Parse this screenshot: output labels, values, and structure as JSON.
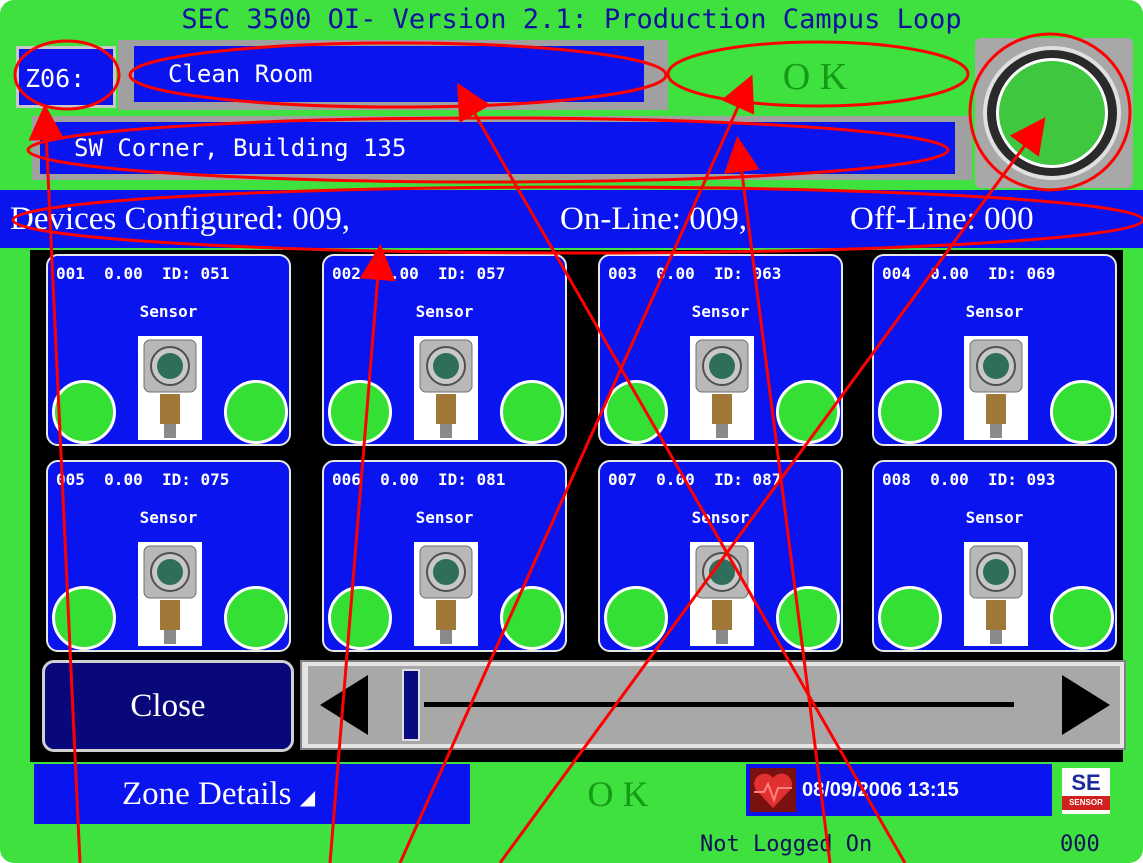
{
  "title": "SEC 3500 OI- Version 2.1: Production Campus Loop",
  "zone": {
    "id": "Z06:",
    "name": "Clean Room",
    "status": "O K",
    "location": "SW Corner, Building 135"
  },
  "summary": {
    "configured": "Devices Configured: 009,",
    "online": "On-Line: 009,",
    "offline": "Off-Line: 000"
  },
  "devices": [
    {
      "number": "001",
      "value": "0.00",
      "id_label": "ID: 051",
      "type": "Sensor"
    },
    {
      "number": "002",
      "value": "0.00",
      "id_label": "ID: 057",
      "type": "Sensor"
    },
    {
      "number": "003",
      "value": "0.00",
      "id_label": "ID: 063",
      "type": "Sensor"
    },
    {
      "number": "004",
      "value": "0.00",
      "id_label": "ID: 069",
      "type": "Sensor"
    },
    {
      "number": "005",
      "value": "0.00",
      "id_label": "ID: 075",
      "type": "Sensor"
    },
    {
      "number": "006",
      "value": "0.00",
      "id_label": "ID: 081",
      "type": "Sensor"
    },
    {
      "number": "007",
      "value": "0.00",
      "id_label": "ID: 087",
      "type": "Sensor"
    },
    {
      "number": "008",
      "value": "0.00",
      "id_label": "ID: 093",
      "type": "Sensor"
    }
  ],
  "controls": {
    "close_label": "Close",
    "zone_details_label": "Zone Details",
    "status_bottom": "O K",
    "datetime": "08/09/2006 13:15",
    "login_status": "Not Logged On",
    "login_code": "000",
    "scroll_position": 0.0
  },
  "logo": {
    "text": "SE",
    "subtext": "SENSOR"
  },
  "colors": {
    "panel": "#3fe13f",
    "field": "#0a14ee",
    "ok_text": "#149a14",
    "annotation": "#ff0000"
  }
}
